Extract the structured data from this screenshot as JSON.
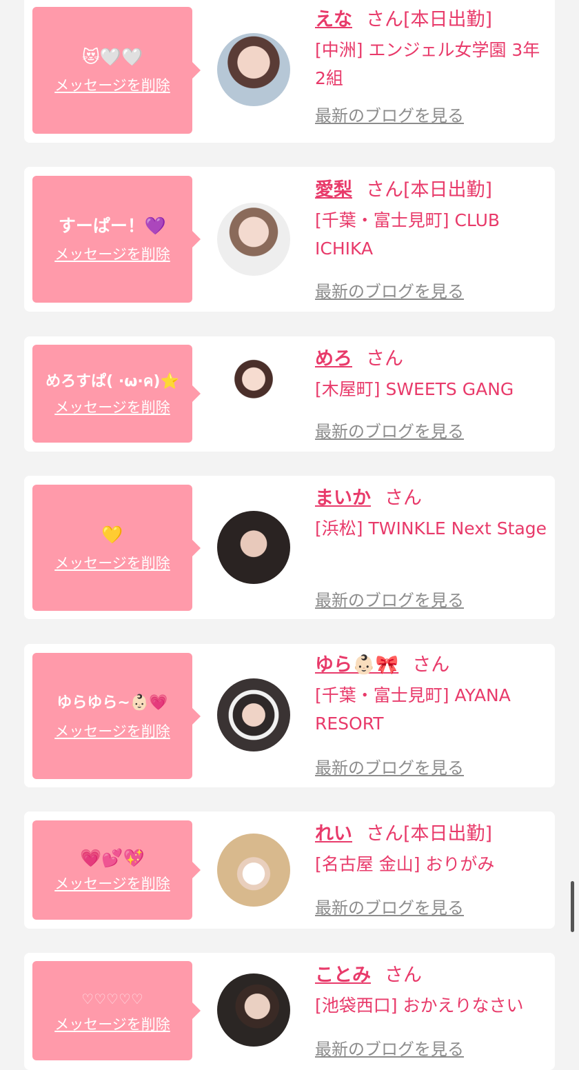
{
  "delete_label": "メッセージを削除",
  "blog_label": "最新のブログを見る",
  "san_label": "さん",
  "entries": [
    {
      "message": "😻🤍🤍",
      "name": "えな",
      "status": "[本日出勤]",
      "shop": "[中洲] エンジェル女学園 3年2組",
      "avatar_icon": "girl-photo"
    },
    {
      "message": "すーぱー！💜",
      "name": "愛梨",
      "status": "[本日出勤]",
      "shop": "[千葉・富士見町] CLUB ICHIKA",
      "avatar_icon": "girl-photo"
    },
    {
      "message": "めろすぱ( ·ω·ค)⭐️",
      "name": "めろ",
      "status": "",
      "shop": "[木屋町] SWEETS GANG",
      "avatar_icon": "girl-photo"
    },
    {
      "message": "💛",
      "name": "まいか",
      "status": "",
      "shop": "[浜松] TWINKLE Next Stage",
      "avatar_icon": "girl-photo"
    },
    {
      "message": "ゆらゆら~👶🏻💗",
      "name": "ゆら👶🏻🎀",
      "status": "",
      "shop": "[千葉・富士見町] AYANA RESORT",
      "avatar_icon": "girl-photo"
    },
    {
      "message": "💗💕💖",
      "name": "れい",
      "status": "[本日出勤]",
      "shop": "[名古屋 金山] おりがみ",
      "avatar_icon": "girl-photo"
    },
    {
      "message": "♡♡♡♡♡",
      "name": "ことみ",
      "status": "",
      "shop": "[池袋西口] おかえりなさい",
      "avatar_icon": "girl-photo"
    }
  ]
}
